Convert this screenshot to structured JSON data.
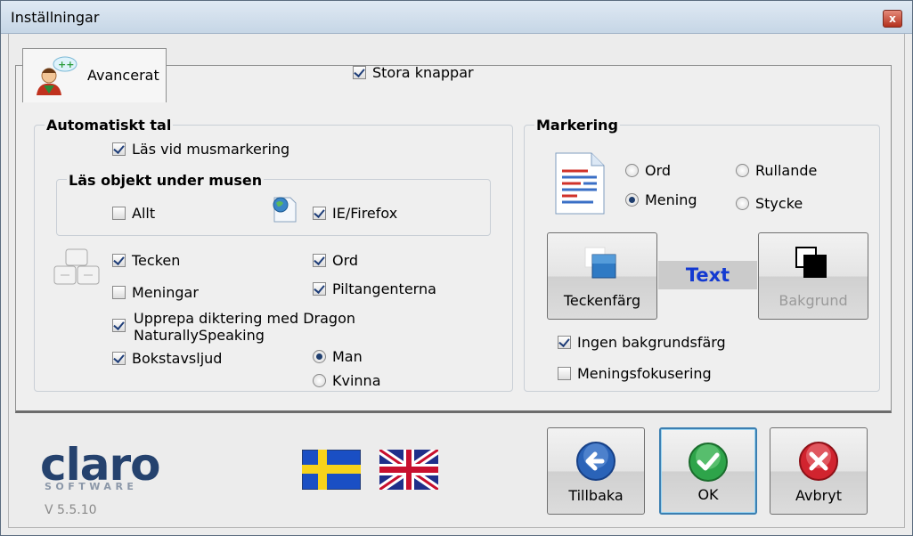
{
  "window": {
    "title": "Inställningar",
    "close_glyph": "x"
  },
  "tab": {
    "label": "Avancerat",
    "icon": "person-speech-icon"
  },
  "large_buttons": {
    "label": "Stora knappar",
    "checked": true
  },
  "auto_speech": {
    "title": "Automatiskt tal",
    "read_on_mouse_selection": {
      "label": "Läs vid musmarkering",
      "checked": true
    },
    "read_objects": {
      "title": "Läs objekt under musen",
      "all": {
        "label": "Allt",
        "checked": false
      },
      "ie_firefox": {
        "label": "IE/Firefox",
        "checked": true,
        "icon": "globe-page-icon"
      }
    },
    "keyboard_icon": "keyboard-icon",
    "characters": {
      "label": "Tecken",
      "checked": true
    },
    "words": {
      "label": "Ord",
      "checked": true
    },
    "sentences": {
      "label": "Meningar",
      "checked": false
    },
    "arrow_keys": {
      "label": "Piltangenterna",
      "checked": true
    },
    "repeat_dragon": {
      "label_line1": "Upprepa diktering med Dragon",
      "label_line2": "NaturallySpeaking",
      "checked": true
    },
    "letter_sounds": {
      "label": "Bokstavsljud",
      "checked": true
    },
    "voice_man": {
      "label": "Man",
      "selected": true
    },
    "voice_woman": {
      "label": "Kvinna",
      "selected": false
    }
  },
  "highlight": {
    "title": "Markering",
    "doc_icon": "document-icon",
    "word": {
      "label": "Ord",
      "selected": false
    },
    "scrolling": {
      "label": "Rullande",
      "selected": false
    },
    "sentence": {
      "label": "Mening",
      "selected": true
    },
    "paragraph": {
      "label": "Stycke",
      "selected": false
    },
    "text_color_button": "Teckenfärg",
    "preview_text": "Text",
    "background_button": "Bakgrund",
    "no_background": {
      "label": "Ingen bakgrundsfärg",
      "checked": true
    },
    "sentence_focus": {
      "label": "Meningsfokusering",
      "checked": false
    }
  },
  "brand": {
    "logo": "claro",
    "sub": "SOFTWARE",
    "version": "V 5.5.10"
  },
  "flags": {
    "swedish": "swedish-flag",
    "english": "uk-flag"
  },
  "buttons": {
    "back": "Tillbaka",
    "ok": "OK",
    "cancel": "Avbryt"
  },
  "colors": {
    "preview_text": "#1339d1",
    "preview_bg": "#cbcbcb",
    "brand": "#25426e"
  }
}
